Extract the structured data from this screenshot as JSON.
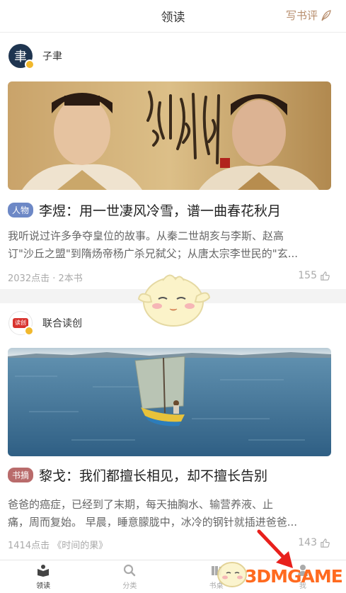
{
  "header": {
    "title": "领读",
    "write_review": "写书评"
  },
  "cards": [
    {
      "author": "子聿",
      "avatar_char": "聿",
      "tag": "人物",
      "title": "李煜：用一世凄风冷雪，谱一曲春花秋月",
      "summary_lines": [
        "我听说过许多争夺皇位的故事。从秦二世胡亥与李斯、赵高",
        "订\"沙丘之盟\"到隋炀帝杨广杀兄弑父；从唐太宗李世民的\"玄..."
      ],
      "meta": "2032点击 · 2本书",
      "likes": "155"
    },
    {
      "author": "联合读创",
      "avatar_char": "读创",
      "tag": "书摘",
      "title": "黎戈：我们都擅长相见，却不擅长告别",
      "summary_lines": [
        " 爸爸的癌症，已经到了末期，每天抽胸水、输营养液、止",
        "痛，周而复始。 早晨，睡意朦胧中，冰冷的钢针就插进爸爸..."
      ],
      "meta": "1414点击 《时间的果》",
      "likes": "143"
    }
  ],
  "tabbar": [
    {
      "label": "领读",
      "icon": "book-reading-icon",
      "active": true
    },
    {
      "label": "分类",
      "icon": "search-icon",
      "active": false
    },
    {
      "label": "书桌",
      "icon": "bookshelf-icon",
      "active": false
    },
    {
      "label": "我",
      "icon": "person-icon",
      "active": false
    }
  ],
  "watermark": {
    "text": "3DMGAME"
  },
  "colors": {
    "accent_brown": "#b78d6c",
    "tag_person": "#6d88c6",
    "tag_excerpt": "#b96b6b",
    "watermark_orange": "#ff6a1f"
  }
}
